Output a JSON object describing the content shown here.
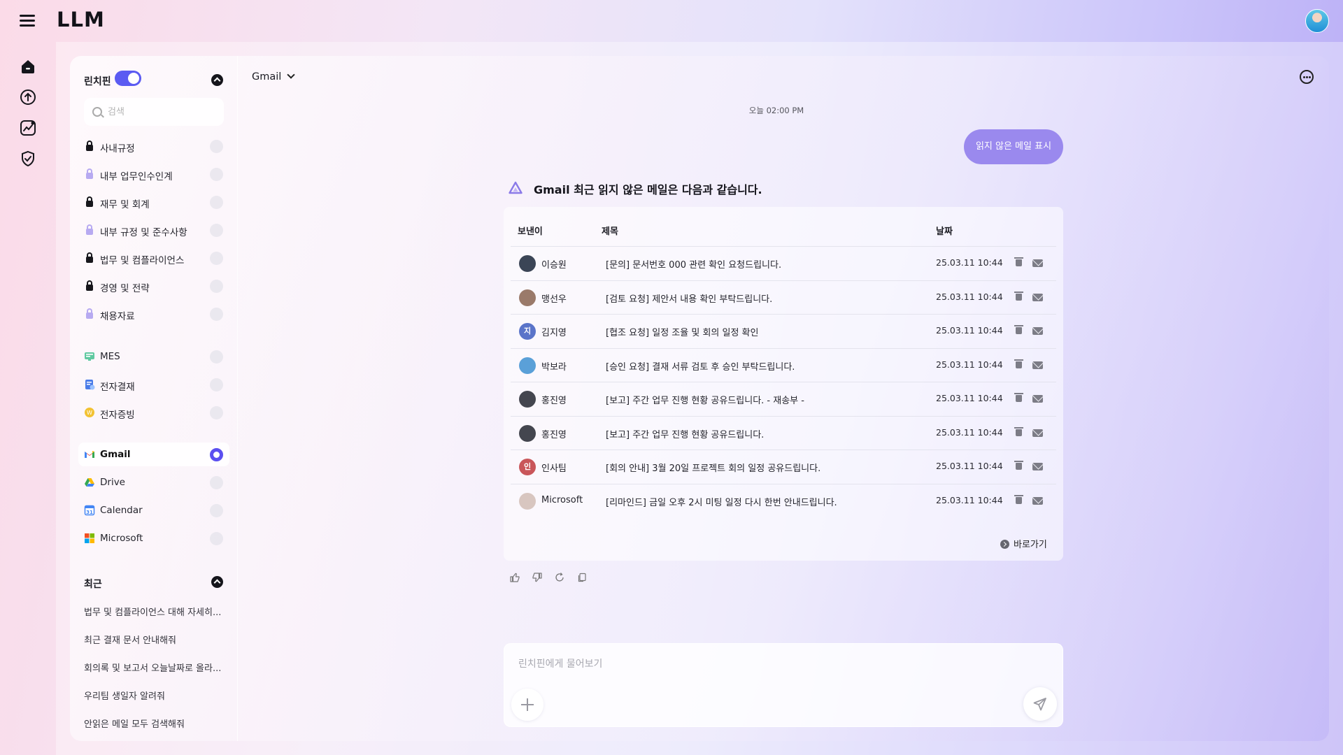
{
  "app": {
    "logo": "LLM"
  },
  "sidebar": {
    "title": "린치핀",
    "search_placeholder": "검색",
    "knowledge": [
      {
        "label": "사내규정",
        "lock": "dark"
      },
      {
        "label": "내부 업무인수인계",
        "lock": "light"
      },
      {
        "label": "재무 및 회계",
        "lock": "dark"
      },
      {
        "label": "내부 규정 및 준수사항",
        "lock": "light"
      },
      {
        "label": "법무 및 컴플라이언스",
        "lock": "dark"
      },
      {
        "label": "경영 및 전략",
        "lock": "dark"
      },
      {
        "label": "채용자료",
        "lock": "light"
      }
    ],
    "systems": [
      {
        "label": "MES",
        "icon": "mes-icon"
      },
      {
        "label": "전자결재",
        "icon": "approval-icon"
      },
      {
        "label": "전자증빙",
        "icon": "receipt-icon"
      }
    ],
    "integrations": [
      {
        "label": "Gmail",
        "icon": "gmail-icon",
        "active": true
      },
      {
        "label": "Drive",
        "icon": "drive-icon",
        "active": false
      },
      {
        "label": "Calendar",
        "icon": "calendar-icon",
        "active": false
      },
      {
        "label": "Microsoft",
        "icon": "microsoft-icon",
        "active": false
      }
    ],
    "recent_title": "최근",
    "recent": [
      "법무 및 컴플라이언스 대해 자세히...",
      "최근 결재 문서 안내해줘",
      "회의록 및 보고서 오늘날짜로 올라...",
      "우리팀 생일자 알려줘",
      "안읽은 메일 모두 검색해줘"
    ]
  },
  "chat": {
    "source_selector": "Gmail",
    "timestamp": "오늘 02:00 PM",
    "user_message": "읽지 않은 메일 표시",
    "bot_intro": "Gmail 최근 읽지 않은 메일은 다음과 같습니다.",
    "table": {
      "headers": {
        "sender": "보낸이",
        "subject": "제목",
        "date": "날짜"
      },
      "rows": [
        {
          "sender": "이승원",
          "subject": "[문의] 문서번호 000 관련 확인 요청드립니다.",
          "date": "25.03.11 10:44",
          "avatar": "",
          "color": "#3b4556"
        },
        {
          "sender": "맹선우",
          "subject": "[검토 요청] 제안서 내용 확인 부탁드립니다.",
          "date": "25.03.11 10:44",
          "avatar": "",
          "color": "#9a7a6a"
        },
        {
          "sender": "김지영",
          "subject": "[협조 요청] 일정 조율 및 회의 일정 확인",
          "date": "25.03.11 10:44",
          "avatar": "지",
          "color": "#5a74c9"
        },
        {
          "sender": "박보라",
          "subject": "[승인 요청] 결재 서류 검토 후 승인 부탁드립니다.",
          "date": "25.03.11 10:44",
          "avatar": "",
          "color": "#5aa0d8"
        },
        {
          "sender": "홍진영",
          "subject": "[보고] 주간 업무 진행 현황 공유드립니다. - 재송부 -",
          "date": "25.03.11 10:44",
          "avatar": "",
          "color": "#44464f"
        },
        {
          "sender": "홍진영",
          "subject": "[보고] 주간 업무 진행 현황 공유드립니다.",
          "date": "25.03.11 10:44",
          "avatar": "",
          "color": "#44464f"
        },
        {
          "sender": "인사팀",
          "subject": "[회의 안내] 3월 20일 프로젝트 회의 일정 공유드립니다.",
          "date": "25.03.11 10:44",
          "avatar": "인",
          "color": "#c9565a"
        },
        {
          "sender": "Microsoft",
          "subject": "[리마인드] 금일 오후 2시 미팅 일정 다시 한번 안내드립니다.",
          "date": "25.03.11 10:44",
          "avatar": "",
          "color": "#d8c6c0"
        }
      ]
    },
    "goto_label": "바로가기",
    "composer_placeholder": "린치핀에게 물어보기"
  },
  "colors": {
    "accent": "#5b4ff0",
    "user_bubble": "#9a89ee"
  }
}
